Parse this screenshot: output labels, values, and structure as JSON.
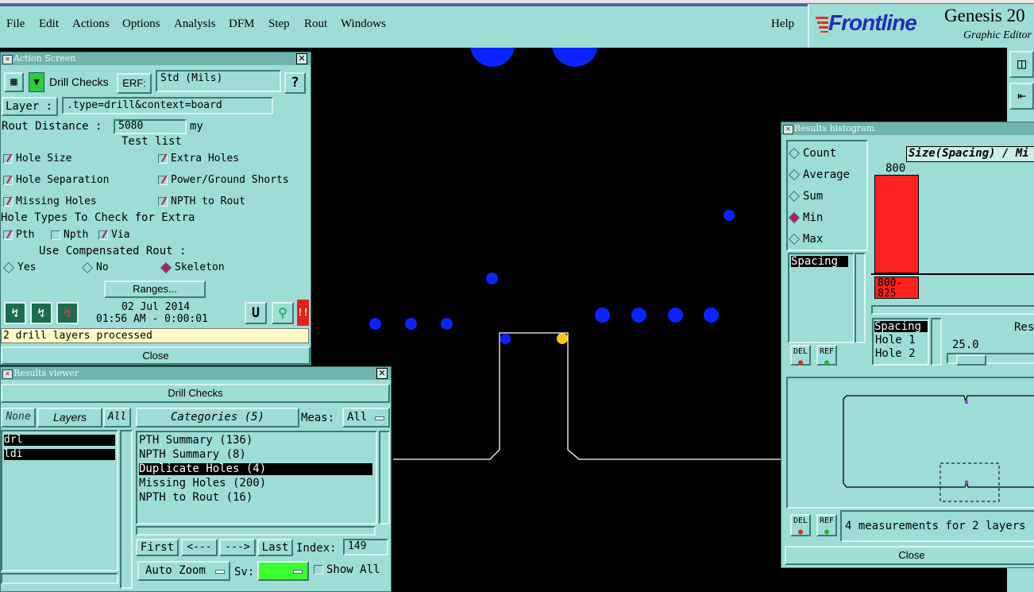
{
  "menubar": {
    "items": [
      "File",
      "Edit",
      "Actions",
      "Options",
      "Analysis",
      "DFM",
      "Step",
      "Rout",
      "Windows"
    ],
    "help": "Help",
    "brand": "Frontline",
    "product_title": "Genesis 20",
    "product_subtitle": "Graphic Editor"
  },
  "action_screen": {
    "title": "Action Screen",
    "action_name": "Drill Checks",
    "erf_label": "ERF:",
    "erf_value": "Std (Mils)",
    "help_btn": "?",
    "layer_label": "Layer :",
    "layer_value": ".type=drill&context=board",
    "rout_distance_label": "Rout Distance :",
    "rout_distance_value": "5080",
    "rout_distance_unit": "my",
    "test_list_label": "Test list",
    "tests": [
      {
        "label": "Hole Size",
        "checked": true
      },
      {
        "label": "Extra Holes",
        "checked": true
      },
      {
        "label": "Hole Separation",
        "checked": true
      },
      {
        "label": "Power/Ground Shorts",
        "checked": true
      },
      {
        "label": "Missing Holes",
        "checked": true
      },
      {
        "label": "NPTH to Rout",
        "checked": true
      }
    ],
    "hole_types_label": "Hole Types To Check for Extra",
    "hole_types": [
      {
        "label": "Pth",
        "checked": true
      },
      {
        "label": "Npth",
        "checked": false
      },
      {
        "label": "Via",
        "checked": true
      }
    ],
    "comp_rout_label": "Use Compensated Rout :",
    "comp_rout_options": [
      {
        "label": "Yes",
        "selected": false
      },
      {
        "label": "No",
        "selected": false
      },
      {
        "label": "Skeleton",
        "selected": true
      }
    ],
    "ranges_btn": "Ranges...",
    "date": "02 Jul 2014",
    "time": "01:56 AM - 0:00:01",
    "u_btn": "U",
    "alert_btn": "!!",
    "status": "2 drill layers processed",
    "close_btn": "Close"
  },
  "results_viewer": {
    "title": "Results viewer",
    "header": "Drill Checks",
    "none_btn": "None",
    "layers_btn": "Layers",
    "all_btn": "All",
    "layers": [
      {
        "name": "drl",
        "selected": true
      },
      {
        "name": "ldi",
        "selected": true
      }
    ],
    "categories_btn": "Categories (5)",
    "meas_label": "Meas:",
    "meas_value": "All",
    "categories": [
      {
        "label": "PTH Summary (136)",
        "selected": false
      },
      {
        "label": "NPTH Summary (8)",
        "selected": false
      },
      {
        "label": "Duplicate Holes (4)",
        "selected": true
      },
      {
        "label": "Missing Holes (200)",
        "selected": false
      },
      {
        "label": "NPTH to Rout (16)",
        "selected": false
      }
    ],
    "first_btn": "First",
    "prev_btn": "<---",
    "next_btn": "--->",
    "last_btn": "Last",
    "index_label": "Index:",
    "index_value": "149",
    "auto_zoom": "Auto Zoom",
    "sv_label": "Sv:",
    "sv_color": "#3cff2e",
    "show_all_label": "Show All",
    "show_all_checked": false
  },
  "histogram": {
    "title": "Results histogram",
    "modes": [
      {
        "label": "Count",
        "selected": false
      },
      {
        "label": "Average",
        "selected": false
      },
      {
        "label": "Sum",
        "selected": false
      },
      {
        "label": "Min",
        "selected": true
      },
      {
        "label": "Max",
        "selected": false
      }
    ],
    "list_item": "Spacing",
    "chart_title": "Size(Spacing) / Mi",
    "bar_value": "800",
    "bar_range": "800-\n825",
    "bar_color": "#ff2020",
    "attr_items": [
      "Spacing",
      "Hole 1",
      "Hole 2"
    ],
    "resolution_label": "Reso",
    "resolution_value": "25.0",
    "del_btn": "DEL",
    "ref_btn": "REF",
    "status": "4 measurements for 2 layers",
    "close_btn": "Close"
  }
}
